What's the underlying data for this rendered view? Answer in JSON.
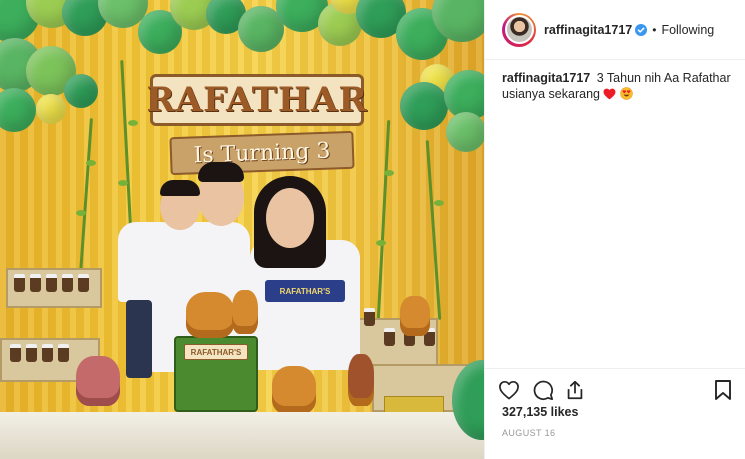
{
  "post": {
    "image": {
      "sign_text": "RAFATHAR",
      "ribbon_text": "Is Turning 3",
      "cake_text": "RAFATHAR'S",
      "shirt_text": "RAFATHAR'S"
    },
    "header": {
      "username": "raffinagita1717",
      "verified_icon": "verified-badge-icon",
      "separator": "•",
      "follow_status": "Following"
    },
    "caption": {
      "username": "raffinagita1717",
      "text_line1": "3 Tahun nih Aa Rafathar",
      "text_line2": "usianya sekarang",
      "emojis": [
        "heart-emoji",
        "heart-eyes-emoji"
      ]
    },
    "actions": {
      "icons": [
        "heart-icon",
        "comment-icon",
        "share-icon",
        "bookmark-icon"
      ]
    },
    "likes": "327,135 likes",
    "date": "AUGUST 16"
  },
  "colors": {
    "verified_blue": "#3897f0",
    "heart_red": "#ed1c24",
    "text_dark": "#262626",
    "text_gray": "#999999"
  }
}
